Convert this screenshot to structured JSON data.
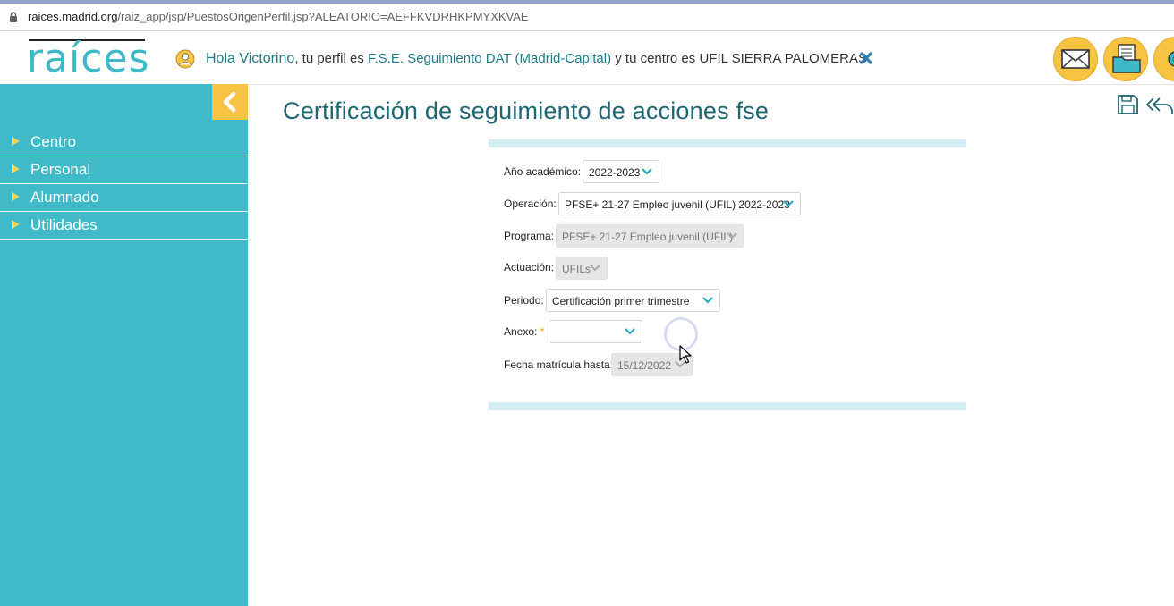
{
  "browser": {
    "url_host": "raices.madrid.org",
    "url_path": "/raiz_app/jsp/PuestosOrigenPerfil.jsp?ALEATORIO=AEFFKVDRHKPMYXKVAE"
  },
  "header": {
    "logo_text": "raíces",
    "greeting": "Hola Victorino",
    "profile_prefix": ", tu perfil es ",
    "profile": "F.S.E. Seguimiento DAT (Madrid-Capital)",
    "center_prefix": " y tu centro es ",
    "center": "UFIL SIERRA PALOMERAS."
  },
  "sidebar": {
    "items": [
      {
        "label": "Centro"
      },
      {
        "label": "Personal"
      },
      {
        "label": "Alumnado"
      },
      {
        "label": "Utilidades"
      }
    ]
  },
  "page": {
    "title": "Certificación de seguimiento de acciones fse"
  },
  "form": {
    "anio": {
      "label": "Año académico:",
      "value": "2022-2023"
    },
    "operacion": {
      "label": "Operación:",
      "value": "PFSE+ 21-27 Empleo juvenil (UFIL) 2022-2023"
    },
    "programa": {
      "label": "Programa:",
      "value": "PFSE+ 21-27 Empleo juvenil (UFIL)"
    },
    "actuacion": {
      "label": "Actuación:",
      "value": "UFILs"
    },
    "periodo": {
      "label": "Periodo:",
      "value": "Certificación primer trimestre"
    },
    "anexo": {
      "label": "Anexo:",
      "required_mark": "*",
      "value": ""
    },
    "fecha": {
      "label": "Fecha matrícula hasta:",
      "value": "15/12/2022"
    }
  },
  "colors": {
    "accent": "#40bac9",
    "highlight": "#f7c342",
    "title": "#1e6673"
  },
  "icons": [
    "lock-icon",
    "user-icon",
    "close-icon",
    "mail-icon",
    "folder-icon",
    "settings-icon",
    "chevron-left-icon",
    "save-icon",
    "back-icon",
    "chevron-down-icon"
  ]
}
